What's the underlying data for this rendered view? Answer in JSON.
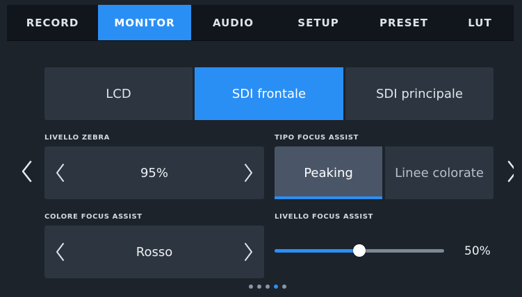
{
  "tabs": [
    {
      "label": "RECORD",
      "active": false
    },
    {
      "label": "MONITOR",
      "active": true
    },
    {
      "label": "AUDIO",
      "active": false
    },
    {
      "label": "SETUP",
      "active": false
    },
    {
      "label": "PRESET",
      "active": false
    },
    {
      "label": "LUT",
      "active": false
    }
  ],
  "outputs": [
    {
      "label": "LCD",
      "active": false
    },
    {
      "label": "SDI frontale",
      "active": true
    },
    {
      "label": "SDI principale",
      "active": false
    }
  ],
  "zebra": {
    "label": "LIVELLO ZEBRA",
    "value": "95%"
  },
  "focus_type": {
    "label": "TIPO FOCUS ASSIST",
    "options": [
      "Peaking",
      "Linee colorate"
    ],
    "selected": "Peaking"
  },
  "focus_color": {
    "label": "COLORE FOCUS ASSIST",
    "value": "Rosso"
  },
  "focus_level": {
    "label": "LIVELLO FOCUS ASSIST",
    "value_text": "50%",
    "fraction": 0.5
  },
  "pager": {
    "count": 5,
    "active_index": 3
  },
  "colors": {
    "accent": "#2a8ff5",
    "panel": "#2c3540",
    "background": "#1c232b",
    "tabbar": "#11161c"
  },
  "icons": {
    "prev": "chevron-left-icon",
    "next": "chevron-right-icon"
  }
}
